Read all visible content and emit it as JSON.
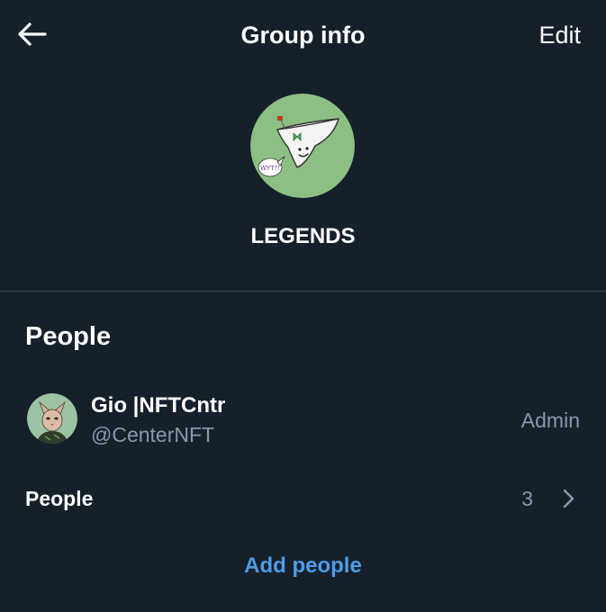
{
  "header": {
    "title": "Group info",
    "edit_label": "Edit",
    "back_icon": "arrow-left-icon"
  },
  "group": {
    "name": "LEGENDS",
    "avatar_bg": "#8cc082",
    "speech_bubble_text": "WYT?!"
  },
  "people_section": {
    "title": "People",
    "members": [
      {
        "name": "Gio |NFTCntr",
        "handle": "@CenterNFT",
        "role": "Admin"
      }
    ],
    "people_row_label": "People",
    "people_count": "3",
    "chevron_icon": "chevron-right-icon",
    "add_people_label": "Add people"
  },
  "colors": {
    "background": "#15202b",
    "divider": "#38444d",
    "secondary_text": "#8b98a5",
    "accent": "#4d9de8"
  }
}
